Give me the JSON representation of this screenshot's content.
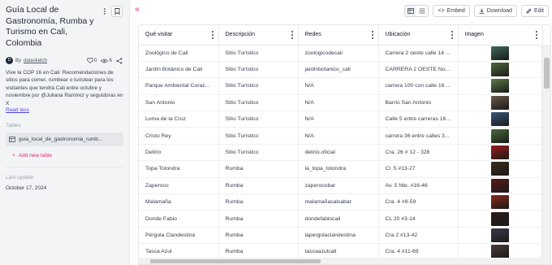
{
  "sidebar": {
    "title": "Guía Local de Gastronomía, Rumba y Turismo en Cali, Colombia",
    "author_initial": "D",
    "author_prefix": "By",
    "author": "datasketch",
    "likes": "0",
    "views": "6",
    "description": "Vive la COP 16 en Cali: Recomendaciones de sitios para comer, rumbear o turistear para los visitantes que tendrá Cali entre octubre y noviembre por @Juliana Ramírez y seguidoras en X",
    "read_less": "Read less",
    "tables_label": "Tables",
    "table_name": "guia_local_de_gastronomia_rumb...",
    "add_table": "Add new table",
    "last_update_label": "Last update",
    "last_update": "October 17, 2024"
  },
  "toolbar": {
    "embed_label": "Embed",
    "download_label": "Download",
    "edit_label": "Edit"
  },
  "table": {
    "columns": [
      "Qué visitar",
      "Descripción",
      "Redes",
      "Ubicación",
      "Imagen"
    ],
    "rows": [
      {
        "visitar": "Zoológico de Cali",
        "desc": "Sitio Turístico",
        "redes": "zoologicodecali",
        "ubic": "Carrera 2 oeste calle 14 ..."
      },
      {
        "visitar": "Jardín Botánico de Cali",
        "desc": "Sitio Turístico",
        "redes": "jardinbotanico_cali",
        "ubic": "CARRERA 2 OESTE No. 2..."
      },
      {
        "visitar": "Parque Ambiental Coraz...",
        "desc": "Sitio Turístico",
        "redes": "N/A",
        "ubic": "carrera 100 con calle 16 ..."
      },
      {
        "visitar": "San Antonio",
        "desc": "Sitio Turístico",
        "redes": "N/A",
        "ubic": "Barrio San Antonio"
      },
      {
        "visitar": "Loma de la Cruz",
        "desc": "Sitio Turístico",
        "redes": "N/A",
        "ubic": "Calle 5 entre carreras 16..."
      },
      {
        "visitar": "Cristo Rey",
        "desc": "Sitio Turístico",
        "redes": "N/A",
        "ubic": "carrera 36 entre calles 3..."
      },
      {
        "visitar": "Delirio",
        "desc": "Sitio Turístico",
        "redes": "delirio.oficial",
        "ubic": "Cra. 26 # 12 - 328"
      },
      {
        "visitar": "Topa Tolondra",
        "desc": "Rumba",
        "redes": "la_topa_tolondra",
        "ubic": "Cl. 5 #13-27"
      },
      {
        "visitar": "Zaperoco",
        "desc": "Rumba",
        "redes": "zaperocobar",
        "ubic": "Av. 5 Nte. #16-46"
      },
      {
        "visitar": "Malamaña",
        "desc": "Rumba",
        "redes": "malamañasalsabar",
        "ubic": "Cra. 4 #9-59"
      },
      {
        "visitar": "Donde Fabio",
        "desc": "Rumba",
        "redes": "dondefabiocali",
        "ubic": "CL 20 #3-14"
      },
      {
        "visitar": "Pérgola Clandestina",
        "desc": "Rumba",
        "redes": "lapergolaclandestina",
        "ubic": "Cra 2 #13-42"
      },
      {
        "visitar": "Tasca Azul",
        "desc": "Rumba",
        "redes": "tascaazulcali",
        "ubic": "Cra. 4 #11-69"
      }
    ]
  },
  "colors": {
    "accent": "#db2777",
    "link": "#4f46e5",
    "thumbs": [
      "#3f6b5a",
      "#4d6b3a",
      "#5b7a48",
      "#6b5a48",
      "#3a5878",
      "#4a6a3a",
      "#9a1b1b",
      "#3a2a1a",
      "#5a1a1a",
      "#8a2a1a",
      "#2a1a1a",
      "#3a3a4a",
      "#4a3a3a"
    ]
  }
}
